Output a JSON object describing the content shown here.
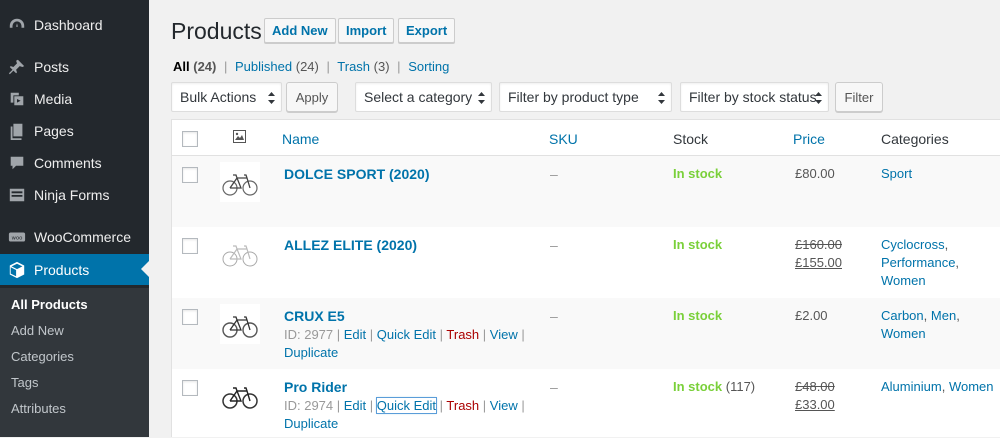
{
  "sidebar": {
    "items": [
      {
        "label": "Dashboard",
        "icon": "dashboard-icon"
      },
      {
        "label": "Posts",
        "icon": "pin-icon"
      },
      {
        "label": "Media",
        "icon": "media-icon"
      },
      {
        "label": "Pages",
        "icon": "pages-icon"
      },
      {
        "label": "Comments",
        "icon": "comment-icon"
      },
      {
        "label": "Ninja Forms",
        "icon": "forms-icon"
      },
      {
        "label": "WooCommerce",
        "icon": "woo-icon"
      },
      {
        "label": "Products",
        "icon": "box-icon"
      }
    ],
    "submenu": [
      "All Products",
      "Add New",
      "Categories",
      "Tags",
      "Attributes"
    ]
  },
  "header": {
    "title": "Products",
    "add_new": "Add New",
    "import": "Import",
    "export": "Export"
  },
  "views": {
    "all": "All",
    "all_count": "(24)",
    "published": "Published",
    "published_count": "(24)",
    "trash": "Trash",
    "trash_count": "(3)",
    "sorting": "Sorting",
    "sep": "|"
  },
  "filters": {
    "bulk_actions": "Bulk Actions",
    "apply": "Apply",
    "category": "Select a category",
    "product_type": "Filter by product type",
    "stock_status": "Filter by stock status",
    "filter": "Filter"
  },
  "table": {
    "columns": {
      "name": "Name",
      "sku": "SKU",
      "stock": "Stock",
      "price": "Price",
      "categories": "Categories"
    },
    "rows": [
      {
        "name": "DOLCE SPORT (2020)",
        "sku": "–",
        "stock": "In stock",
        "stock_qty": "",
        "price": "£80.00",
        "sale_price": "",
        "categories": [
          {
            "t": "Sport",
            "sep": ""
          }
        ]
      },
      {
        "name": "ALLEZ ELITE (2020)",
        "sku": "–",
        "stock": "In stock",
        "stock_qty": "",
        "price": "£160.00",
        "sale_price": "£155.00",
        "categories": [
          {
            "t": "Cyclocross",
            "sep": ","
          },
          {
            "t": "Performance",
            "sep": ","
          },
          {
            "t": "Women",
            "sep": ""
          }
        ]
      },
      {
        "name": "CRUX E5",
        "sku": "–",
        "stock": "In stock",
        "stock_qty": "",
        "price": "£2.00",
        "sale_price": "",
        "categories": [
          {
            "t": "Carbon",
            "sep": ","
          },
          {
            "t": "Men",
            "sep": ","
          },
          {
            "t": "Women",
            "sep": ""
          }
        ],
        "actions": {
          "id": "ID: 2977",
          "edit": "Edit",
          "quick_edit": "Quick Edit",
          "trash": "Trash",
          "view": "View",
          "duplicate": "Duplicate"
        }
      },
      {
        "name": "Pro Rider",
        "sku": "–",
        "stock": "In stock",
        "stock_qty": "(117)",
        "price": "£48.00",
        "sale_price": "£33.00",
        "categories": [
          {
            "t": "Aluminium",
            "sep": ","
          },
          {
            "t": "Women",
            "sep": ""
          }
        ],
        "actions": {
          "id": "ID: 2974",
          "edit": "Edit",
          "quick_edit": "Quick Edit",
          "trash": "Trash",
          "view": "View",
          "duplicate": "Duplicate"
        }
      }
    ]
  },
  "colors": {
    "accent": "#0073aa",
    "sidebar_bg": "#23282d",
    "in_stock": "#7ad03a",
    "trash": "#a00"
  }
}
